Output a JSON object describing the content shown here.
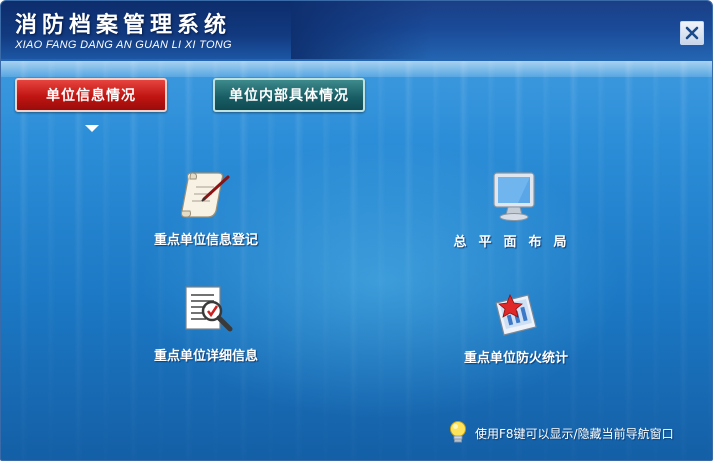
{
  "window": {
    "title": "消防档案管理系统",
    "subtitle": "XIAO FANG DANG AN GUAN LI XI TONG",
    "close_icon": "close-icon"
  },
  "tabs": [
    {
      "label": "单位信息情况",
      "active": true
    },
    {
      "label": "单位内部具体情况",
      "active": false
    }
  ],
  "items": [
    {
      "label": "重点单位信息登记",
      "icon": "scroll-pen-icon"
    },
    {
      "label": "总平面布局",
      "icon": "monitor-icon"
    },
    {
      "label": "重点单位详细信息",
      "icon": "document-magnifier-icon"
    },
    {
      "label": "重点单位防火统计",
      "icon": "chart-document-icon"
    }
  ],
  "hint": {
    "text": "使用F8键可以显示/隐藏当前导航窗口",
    "icon": "lightbulb-icon"
  },
  "colors": {
    "accent_red": "#c01512",
    "accent_teal": "#1a5f66",
    "background_blue": "#2c8ed8"
  }
}
